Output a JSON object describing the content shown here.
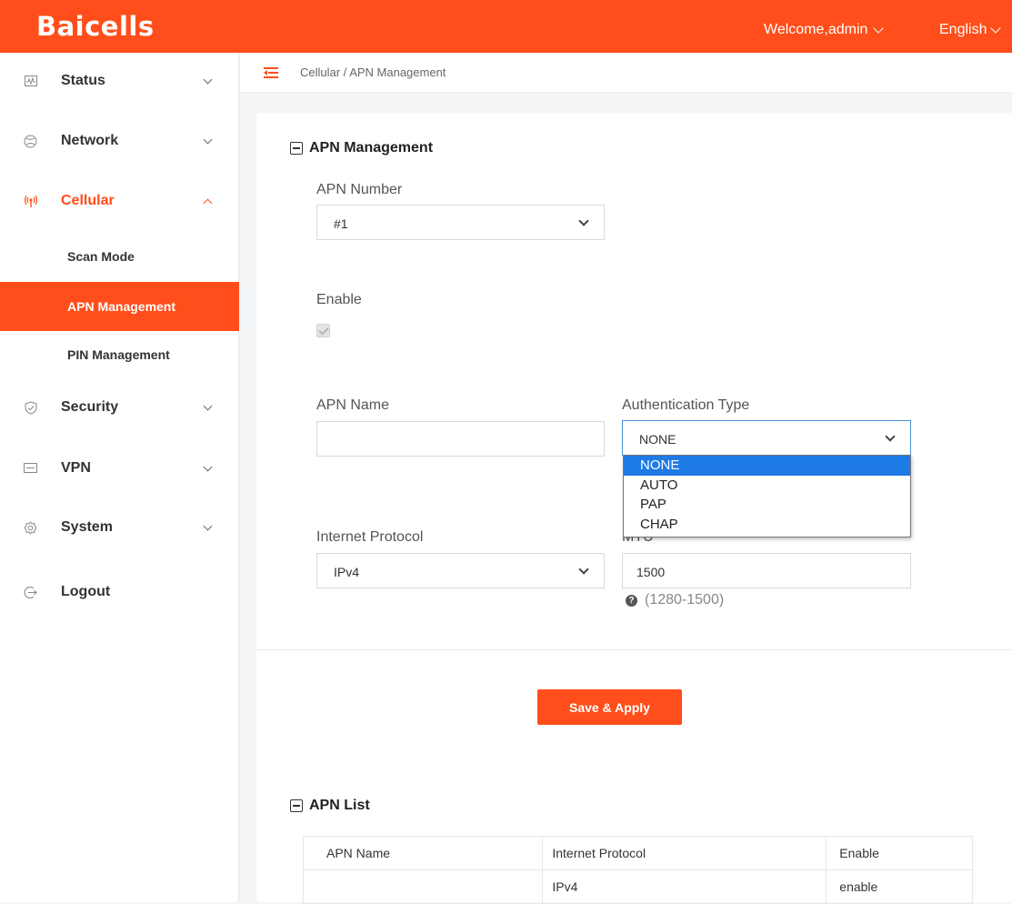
{
  "header": {
    "logo": "Baicells",
    "welcome": "Welcome,admin",
    "language": "English"
  },
  "sidebar": {
    "items": [
      {
        "label": "Status",
        "icon": "activity-icon"
      },
      {
        "label": "Network",
        "icon": "globe-icon"
      },
      {
        "label": "Cellular",
        "icon": "antenna-icon",
        "expanded": true,
        "children": [
          {
            "label": "Scan Mode"
          },
          {
            "label": "APN Management",
            "selected": true
          },
          {
            "label": "PIN Management"
          }
        ]
      },
      {
        "label": "Security",
        "icon": "shield-icon"
      },
      {
        "label": "VPN",
        "icon": "vpn-icon"
      },
      {
        "label": "System",
        "icon": "gear-icon"
      },
      {
        "label": "Logout",
        "icon": "logout-icon"
      }
    ]
  },
  "breadcrumb": "Cellular / APN Management",
  "colors": {
    "accent": "#ff4e1b",
    "highlight": "#1e7be6"
  },
  "apn_management": {
    "title": "APN Management",
    "apn_number_label": "APN Number",
    "apn_number_value": "#1",
    "enable_label": "Enable",
    "enable_checked": true,
    "apn_name_label": "APN Name",
    "apn_name_value": "",
    "auth_type_label": "Authentication Type",
    "auth_type_value": "NONE",
    "auth_type_options": [
      "NONE",
      "AUTO",
      "PAP",
      "CHAP"
    ],
    "internet_protocol_label": "Internet Protocol",
    "internet_protocol_value": "IPv4",
    "mtu_label": "MTU",
    "mtu_value": "1500",
    "mtu_hint": "(1280-1500)"
  },
  "save_button": "Save & Apply",
  "apn_list": {
    "title": "APN List",
    "columns": [
      "APN Name",
      "Internet Protocol",
      "Enable"
    ],
    "rows": [
      [
        "",
        "IPv4",
        "enable"
      ]
    ]
  }
}
